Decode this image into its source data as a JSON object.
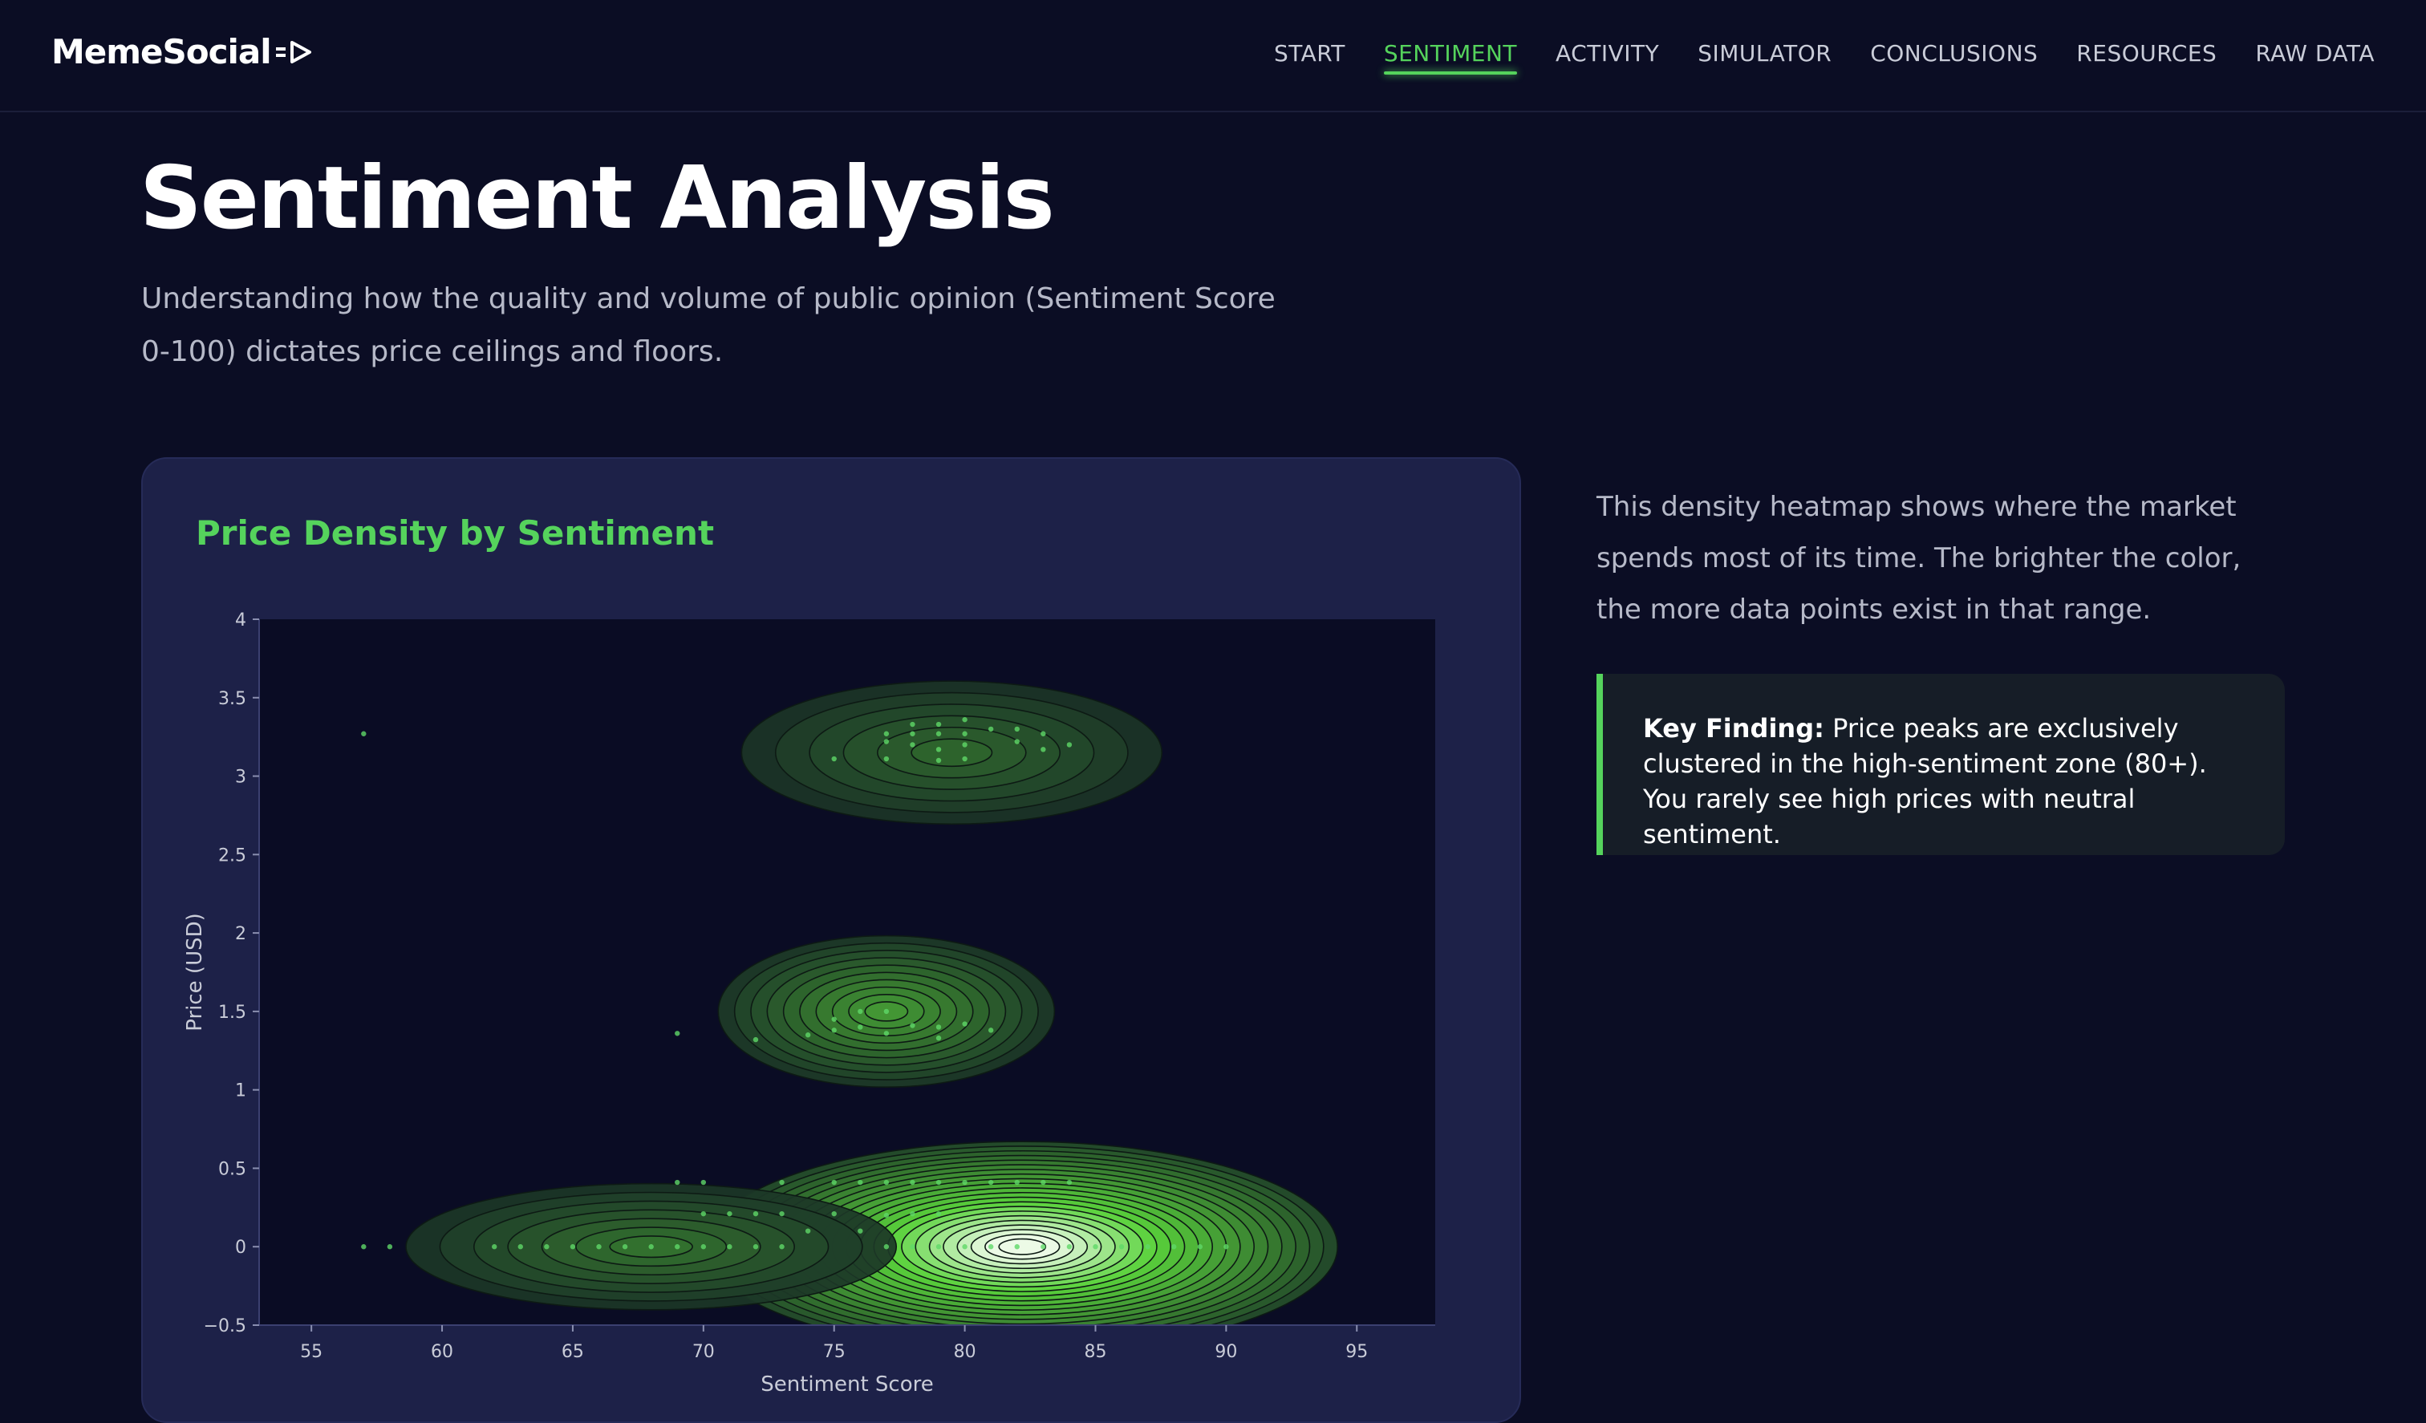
{
  "brand": {
    "name": "MemeSocial"
  },
  "nav": {
    "items": [
      {
        "label": "START",
        "active": false
      },
      {
        "label": "SENTIMENT",
        "active": true
      },
      {
        "label": "ACTIVITY",
        "active": false
      },
      {
        "label": "SIMULATOR",
        "active": false
      },
      {
        "label": "CONCLUSIONS",
        "active": false
      },
      {
        "label": "RESOURCES",
        "active": false
      },
      {
        "label": "RAW DATA",
        "active": false
      }
    ]
  },
  "header": {
    "title": "Sentiment Analysis",
    "subtitle": "Understanding how the quality and volume of public opinion (Sentiment Score 0-100) dictates price ceilings and floors."
  },
  "card": {
    "title": "Price Density by Sentiment"
  },
  "side": {
    "description": "This density heatmap shows where the market spends most of its time. The brighter the color, the more data points exist in that range.",
    "finding_label": "Key Finding:",
    "finding_text": " Price peaks are exclusively clustered in the high-sentiment zone (80+). You rarely see high prices with neutral sentiment."
  },
  "colors": {
    "accent": "#55d35c",
    "background": "#0b0d24",
    "card": "#1d2148",
    "plot_bg": "#0a0c24"
  },
  "chart_data": {
    "type": "heatmap",
    "title": "",
    "xlabel": "Sentiment Score",
    "ylabel": "Price (USD)",
    "xlim": [
      53,
      98
    ],
    "ylim": [
      -0.5,
      4
    ],
    "x_ticks": [
      55,
      60,
      65,
      70,
      75,
      80,
      85,
      90,
      95
    ],
    "y_ticks": [
      -0.5,
      0,
      0.5,
      1,
      1.5,
      2,
      2.5,
      3,
      3.5,
      4
    ],
    "y_tick_labels": [
      "−0.5",
      "0",
      "0.5",
      "1",
      "1.5",
      "2",
      "2.5",
      "3",
      "3.5",
      "4"
    ],
    "grid": false,
    "density_clusters": [
      {
        "center": [
          82.2,
          0.0
        ],
        "spread": [
          4.5,
          0.25
        ],
        "peak": 1.0
      },
      {
        "center": [
          77.0,
          1.5
        ],
        "spread": [
          2.4,
          0.18
        ],
        "peak": 0.45
      },
      {
        "center": [
          79.5,
          3.15
        ],
        "spread": [
          3.0,
          0.17
        ],
        "peak": 0.25
      },
      {
        "center": [
          68.0,
          0.0
        ],
        "spread": [
          3.5,
          0.15
        ],
        "peak": 0.3
      }
    ],
    "points": [
      [
        57,
        3.27
      ],
      [
        75,
        3.11
      ],
      [
        77,
        3.27
      ],
      [
        77,
        3.22
      ],
      [
        77,
        3.11
      ],
      [
        78,
        3.33
      ],
      [
        78,
        3.27
      ],
      [
        78,
        3.2
      ],
      [
        79,
        3.33
      ],
      [
        79,
        3.27
      ],
      [
        79,
        3.17
      ],
      [
        79,
        3.1
      ],
      [
        80,
        3.36
      ],
      [
        80,
        3.27
      ],
      [
        80,
        3.2
      ],
      [
        80,
        3.11
      ],
      [
        81,
        3.3
      ],
      [
        82,
        3.3
      ],
      [
        82,
        3.22
      ],
      [
        83,
        3.27
      ],
      [
        83,
        3.17
      ],
      [
        84,
        3.2
      ],
      [
        69,
        1.36
      ],
      [
        72,
        1.32
      ],
      [
        74,
        1.35
      ],
      [
        75,
        1.38
      ],
      [
        75,
        1.45
      ],
      [
        76,
        1.5
      ],
      [
        76,
        1.4
      ],
      [
        77,
        1.5
      ],
      [
        77,
        1.36
      ],
      [
        78,
        1.41
      ],
      [
        79,
        1.4
      ],
      [
        79,
        1.33
      ],
      [
        80,
        1.42
      ],
      [
        81,
        1.38
      ],
      [
        57,
        0.0
      ],
      [
        58,
        0.0
      ],
      [
        62,
        0.0
      ],
      [
        63,
        0.0
      ],
      [
        64,
        0.0
      ],
      [
        65,
        0.0
      ],
      [
        66,
        0.0
      ],
      [
        67,
        0.0
      ],
      [
        68,
        0.0
      ],
      [
        69,
        0.0
      ],
      [
        70,
        0.0
      ],
      [
        71,
        0.0
      ],
      [
        72,
        0.0
      ],
      [
        73,
        0.0
      ],
      [
        69,
        0.41
      ],
      [
        70,
        0.41
      ],
      [
        70,
        0.21
      ],
      [
        71,
        0.21
      ],
      [
        72,
        0.21
      ],
      [
        73,
        0.21
      ],
      [
        73,
        0.41
      ],
      [
        74,
        0.1
      ],
      [
        75,
        0.41
      ],
      [
        75,
        0.21
      ],
      [
        76,
        0.1
      ],
      [
        76,
        0.41
      ],
      [
        77,
        0.41
      ],
      [
        77,
        0.2
      ],
      [
        77,
        0.0
      ],
      [
        78,
        0.41
      ],
      [
        78,
        0.21
      ],
      [
        78,
        0.0
      ],
      [
        79,
        0.41
      ],
      [
        79,
        0.21
      ],
      [
        79,
        0.0
      ],
      [
        80,
        0.41
      ],
      [
        80,
        0.0
      ],
      [
        81,
        0.41
      ],
      [
        81,
        0.0
      ],
      [
        82,
        0.41
      ],
      [
        82,
        0.0
      ],
      [
        83,
        0.41
      ],
      [
        83,
        0.0
      ],
      [
        84,
        0.41
      ],
      [
        84,
        0.0
      ],
      [
        85,
        0.0
      ],
      [
        86,
        0.0
      ],
      [
        87,
        0.0
      ],
      [
        88,
        0.0
      ],
      [
        89,
        0.0
      ],
      [
        90,
        0.0
      ]
    ]
  }
}
